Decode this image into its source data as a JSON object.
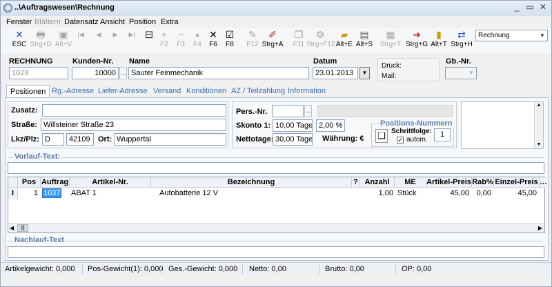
{
  "window": {
    "title": "..\\Auftragswesen\\Rechnung",
    "btn_min": "_",
    "btn_max": "▭",
    "btn_close": "✕"
  },
  "menu": [
    "Fenster",
    "Blättern",
    "Datensatz",
    "Ansicht",
    "Position",
    "Extra"
  ],
  "toolbar": {
    "esc": "ESC",
    "strg_d": "Strg+D",
    "alt_v": "Alt+V",
    "f2": "F2",
    "f3": "F3",
    "f4": "F4",
    "f6": "F6",
    "f8": "F8",
    "f12": "F12",
    "strg_a": "Strg+A",
    "f11": "F11",
    "strg_f12": "Strg+F12",
    "alt_e": "Alt+E",
    "alt_s": "Alt+S",
    "strg_t": "Strg+T",
    "strg_g": "Strg+G",
    "alt_t": "Alt+T",
    "strg_h": "Strg+H",
    "dropdown_value": "Rechnung"
  },
  "header": {
    "rechnung_label": "RECHNUNG",
    "rechnung_value": "1028",
    "kunden_label": "Kunden-Nr.",
    "kunden_value": "10000",
    "name_label": "Name",
    "name_value": "Sauter Feinmechanik",
    "datum_label": "Datum",
    "datum_value": "23.01.2013",
    "druck_label": "Druck:",
    "mail_label": "Mail:",
    "gbnr_label": "Gb.-Nr.",
    "lookup_dots": "..."
  },
  "tabs": [
    "Positionen",
    "Rg.-Adresse",
    "Liefer-Adresse",
    "Versand",
    "Konditionen",
    "AZ / Teilzahlung",
    "Information"
  ],
  "address": {
    "zusatz_label": "Zusatz:",
    "zusatz_value": "",
    "strasse_label": "Straße:",
    "strasse_value": "Willsteiner Straße 23",
    "lkz_label": "Lkz/Plz:",
    "lkz_value": "D",
    "plz_value": "42109",
    "ort_label": "Ort:",
    "ort_value": "Wuppertal"
  },
  "payment": {
    "pers_label": "Pers.-Nr.",
    "pers_value": "",
    "skonto_label": "Skonto 1:",
    "skonto_days": "10,00 Tage",
    "skonto_pct": "2,00 %",
    "netto_label": "Nettotage:",
    "netto_days": "30,00 Tage",
    "waehrung_label": "Währung: €"
  },
  "posnum": {
    "title": "Positions-Nummern",
    "schrittfolge_label": "Schrittfolge:",
    "schrittfolge_value": "1",
    "autom_label": "autom.",
    "autom_checked": true
  },
  "vorlauf_label": "Vorlauf-Text:",
  "nachlauf_label": "Nachlauf-Text",
  "table": {
    "headers": [
      "Pos",
      "Auftrag",
      "Artikel-Nr.",
      "Bezeichnung",
      "?",
      "Anzahl",
      "ME",
      "Artikel-Preis",
      "Rab%",
      "Einzel-Preis"
    ],
    "rows": [
      {
        "marker": "I",
        "pos": "1",
        "auftrag": "1037",
        "artikel": "ABAT 1",
        "bezeichnung": "Autobatterie 12 V",
        "q": "",
        "anzahl": "1,00",
        "me": "Stück",
        "preis": "45,00",
        "rab": "0,00",
        "einzel": "45,00"
      }
    ]
  },
  "status": {
    "artikelgewicht": "Artikelgewicht: 0,000",
    "posgewicht": "Pos-Gewicht(1): 0,000",
    "gesgewicht": "Ges.-Gewicht: 0,000",
    "netto": "Netto: 0,00",
    "brutto": "Brutto: 0,00",
    "op": "OP: 0,00"
  },
  "colors": {
    "accent": "#3a6fb0",
    "selection": "#3399ff",
    "section": "#5a7da8"
  }
}
